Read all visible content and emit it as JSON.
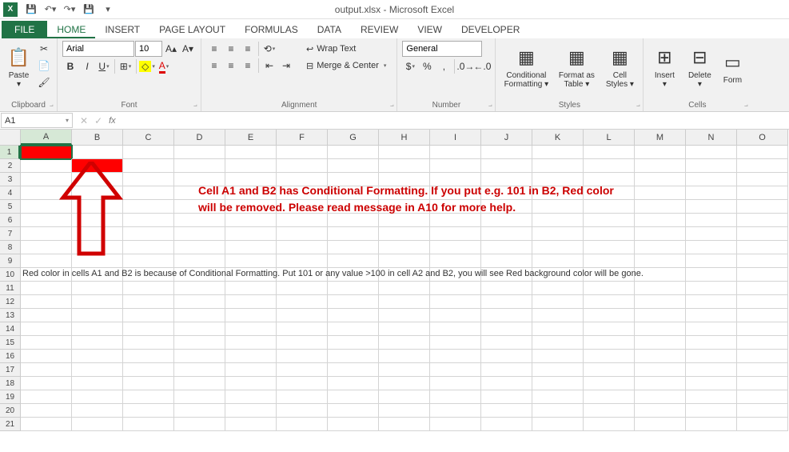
{
  "app": {
    "title": "output.xlsx - Microsoft Excel"
  },
  "tabs": {
    "file": "FILE",
    "list": [
      "HOME",
      "INSERT",
      "PAGE LAYOUT",
      "FORMULAS",
      "DATA",
      "REVIEW",
      "VIEW",
      "DEVELOPER"
    ],
    "active_index": 0
  },
  "ribbon": {
    "clipboard": {
      "label": "Clipboard",
      "paste": "Paste"
    },
    "font": {
      "label": "Font",
      "name": "Arial",
      "size": "10",
      "bold": "B",
      "italic": "I",
      "underline": "U"
    },
    "alignment": {
      "label": "Alignment",
      "wrap": "Wrap Text",
      "merge": "Merge & Center"
    },
    "number": {
      "label": "Number",
      "format": "General",
      "currency": "$",
      "percent": "%",
      "comma": ","
    },
    "styles": {
      "label": "Styles",
      "cond": "Conditional Formatting",
      "table": "Format as Table",
      "cell": "Cell Styles"
    },
    "cells": {
      "label": "Cells",
      "insert": "Insert",
      "delete": "Delete",
      "format": "Form"
    }
  },
  "namebox": "A1",
  "grid": {
    "cols": [
      "A",
      "B",
      "C",
      "D",
      "E",
      "F",
      "G",
      "H",
      "I",
      "J",
      "K",
      "L",
      "M",
      "N",
      "O"
    ],
    "rows": 21,
    "selected_cell": "A1",
    "red_cells": [
      "A1",
      "B2"
    ],
    "row10_text": "Red color in cells A1 and B2 is because of Conditional Formatting. Put 101 or any value >100 in cell A2 and B2, you will see Red background color will be gone."
  },
  "callout": {
    "line1": "Cell A1 and B2 has Conditional Formatting. If you put e.g. 101 in B2, Red color",
    "line2": "will be removed. Please read message in A10 for more help."
  }
}
